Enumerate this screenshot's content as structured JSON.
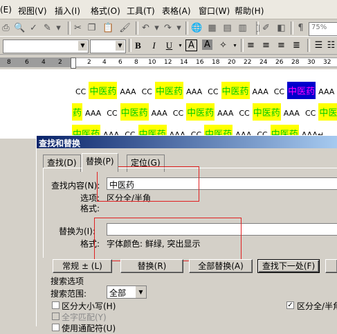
{
  "menu": [
    "(E)",
    "视图(V)",
    "插入(I)",
    "格式(O)",
    "工具(T)",
    "表格(A)",
    "窗口(W)",
    "帮助(H)"
  ],
  "toolbar": {
    "zoom": "75%",
    "bold": "B",
    "italic": "I",
    "underline": "U"
  },
  "ruler": [
    "8",
    "6",
    "4",
    "2",
    "2",
    "4",
    "6",
    "8",
    "10",
    "12",
    "14",
    "16",
    "18",
    "20",
    "22",
    "24",
    "26",
    "28",
    "30",
    "32"
  ],
  "document": {
    "line1": [
      "CC",
      "中医药",
      "AAA",
      "CC",
      "中医药",
      "AAA",
      "CC",
      "中医药",
      "AAA",
      "CC",
      "中医药",
      "AAA",
      "CC"
    ],
    "line2": [
      "药",
      "AAA",
      "CC",
      "中医药",
      "AAA",
      "CC",
      "中医药",
      "AAA",
      "CC",
      "中医药",
      "AAA",
      "CC",
      "中医药"
    ],
    "line3": [
      "中医药",
      "AAA",
      "CC",
      "中医药",
      "AAA",
      "CC",
      "中医药",
      "AAA",
      "CC",
      "中医药",
      "AAA↵"
    ]
  },
  "dialog": {
    "title": "查找和替换",
    "tabs": [
      "查找(D)",
      "替换(P)",
      "定位(G)"
    ],
    "find_label": "查找内容(N):",
    "find_value": "中医药",
    "options_label": "选项:",
    "options_value": "区分全/半角",
    "format_label": "格式:",
    "replace_label": "替换为(I):",
    "replace_value": "",
    "replace_format_label": "格式:",
    "replace_format_value": "字体颜色: 鲜绿, 突出显示",
    "btn_more": "常规 ± (L)",
    "btn_replace": "替换(R)",
    "btn_replace_all": "全部替换(A)",
    "btn_find_next": "查找下一处(F)",
    "search_options": "搜索选项",
    "search_scope_label": "搜索范围:",
    "search_scope_value": "全部",
    "match_case": "区分大小写(H)",
    "whole_word": "全字匹配(Y)",
    "wildcards": "使用通配符(U)",
    "match_width": "区分全/半角"
  }
}
